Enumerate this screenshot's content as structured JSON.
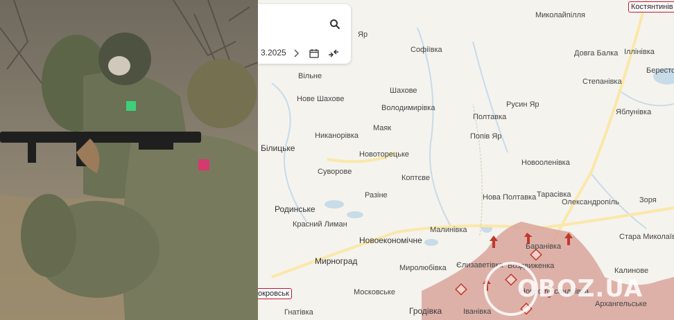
{
  "map": {
    "date_partial": "3.2025",
    "labels": {
      "kostiantynivka": "Костянтинів",
      "pokrovsk": "окровськ",
      "mykolaipillia": "Миколайпілля",
      "dovha_balka": "Довга Балка",
      "illinivka": "Іллінівка",
      "berestok": "Бересток",
      "yar": "Яр",
      "sofiivka": "Софіївка",
      "stepanivka": "Степанівка",
      "vilne": "Вільне",
      "shakhove": "Шахове",
      "nove_shakhove": "Нове Шахове",
      "volodymyrivka": "Володимирівка",
      "rusyn_yar": "Русин Яр",
      "yablunivka": "Яблунівка",
      "poltavka": "Полтавка",
      "maiak": "Маяк",
      "popiv_yar": "Попів Яр",
      "bilytske": "Білицьке",
      "nykanorivka": "Никанорівка",
      "novotoretske": "Новоторецьке",
      "novoolenivka": "Новооленівка",
      "suvorove": "Суворове",
      "koptieve": "Коптєве",
      "razine": "Разіне",
      "nova_poltavka": "Нова Полтавка",
      "tarasivka": "Тарасівка",
      "zoria": "Зоря",
      "oleksandropil": "Олександропіль",
      "rodynske": "Родинське",
      "krasnyi_lyman": "Красний Лиман",
      "malynivka": "Малинівка",
      "baranivka": "Баранівка",
      "stara_mykolaivka": "Стара Миколаївка",
      "novoekonomichne": "Новоекономічне",
      "myrnohrad": "Мирноград",
      "yelyzavetivka": "Єлизаветівка",
      "vozdvyzhenka": "Воздвиженка",
      "myrolubivka": "Миролюбівка",
      "kalynove": "Калинове",
      "novooleksandrivka": "Новоолександрівка",
      "moskovske": "Московське",
      "arkhanhelske": "Архангельське",
      "hnativka": "Гнатівка",
      "hrodivka": "Гродівка",
      "ivanivka": "Іванівка"
    }
  },
  "watermark": {
    "text": "OBOZ.UA"
  },
  "colors": {
    "occupied_area": "#d9a59b",
    "attack_arrow": "#c0392b",
    "city_outline": "#c8102e",
    "river": "#c7dbe8",
    "road": "#fbe7a8"
  }
}
